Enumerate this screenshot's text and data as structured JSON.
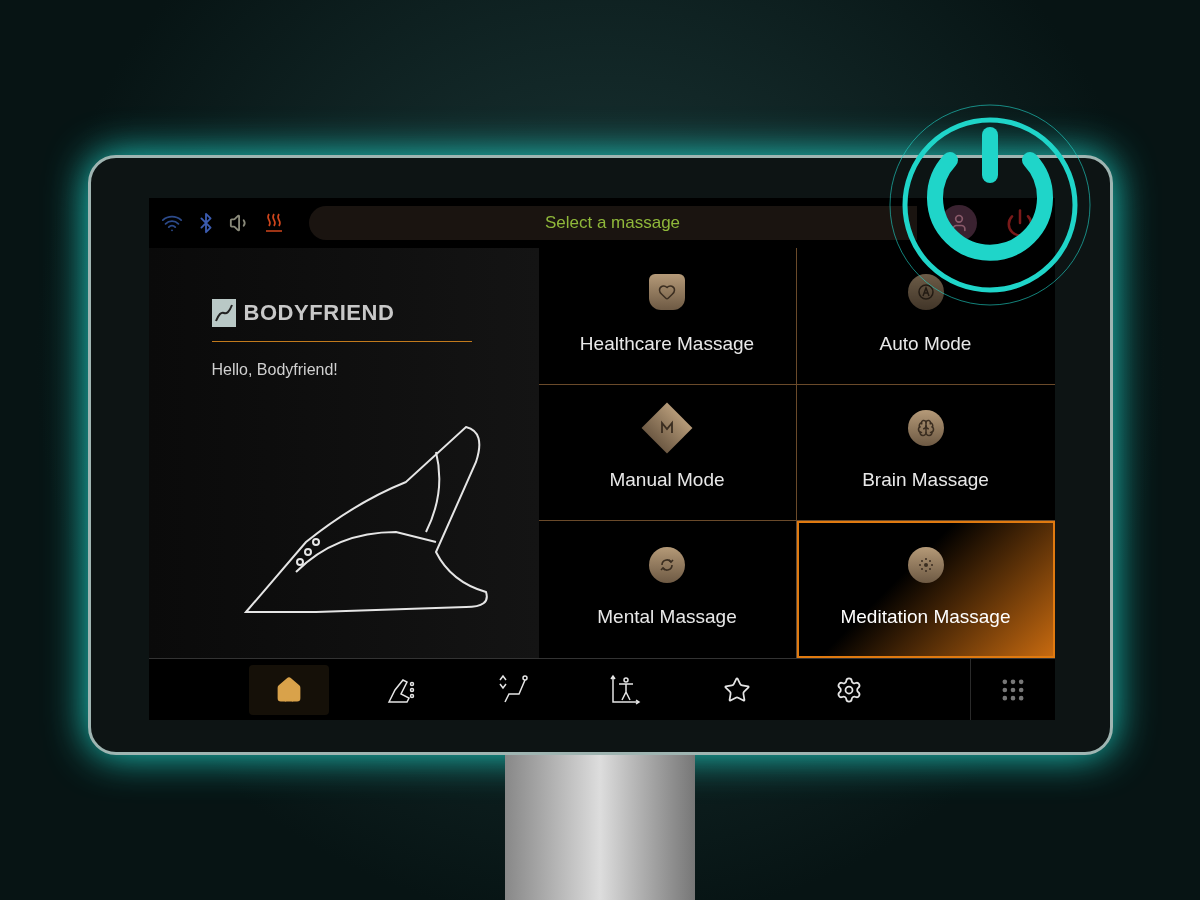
{
  "top_bar": {
    "title": "Select a massage"
  },
  "brand": {
    "name": "BODYFRIEND",
    "greeting": "Hello, Bodyfriend!"
  },
  "menu": [
    {
      "label": "Healthcare Massage",
      "selected": false
    },
    {
      "label": "Auto Mode",
      "selected": false
    },
    {
      "label": "Manual Mode",
      "selected": false
    },
    {
      "label": "Brain Massage",
      "selected": false
    },
    {
      "label": "Mental Massage",
      "selected": false
    },
    {
      "label": "Meditation Massage",
      "selected": true
    }
  ],
  "nav": [
    {
      "selected": true
    },
    {
      "selected": false
    },
    {
      "selected": false
    },
    {
      "selected": false
    },
    {
      "selected": false
    },
    {
      "selected": false
    }
  ]
}
